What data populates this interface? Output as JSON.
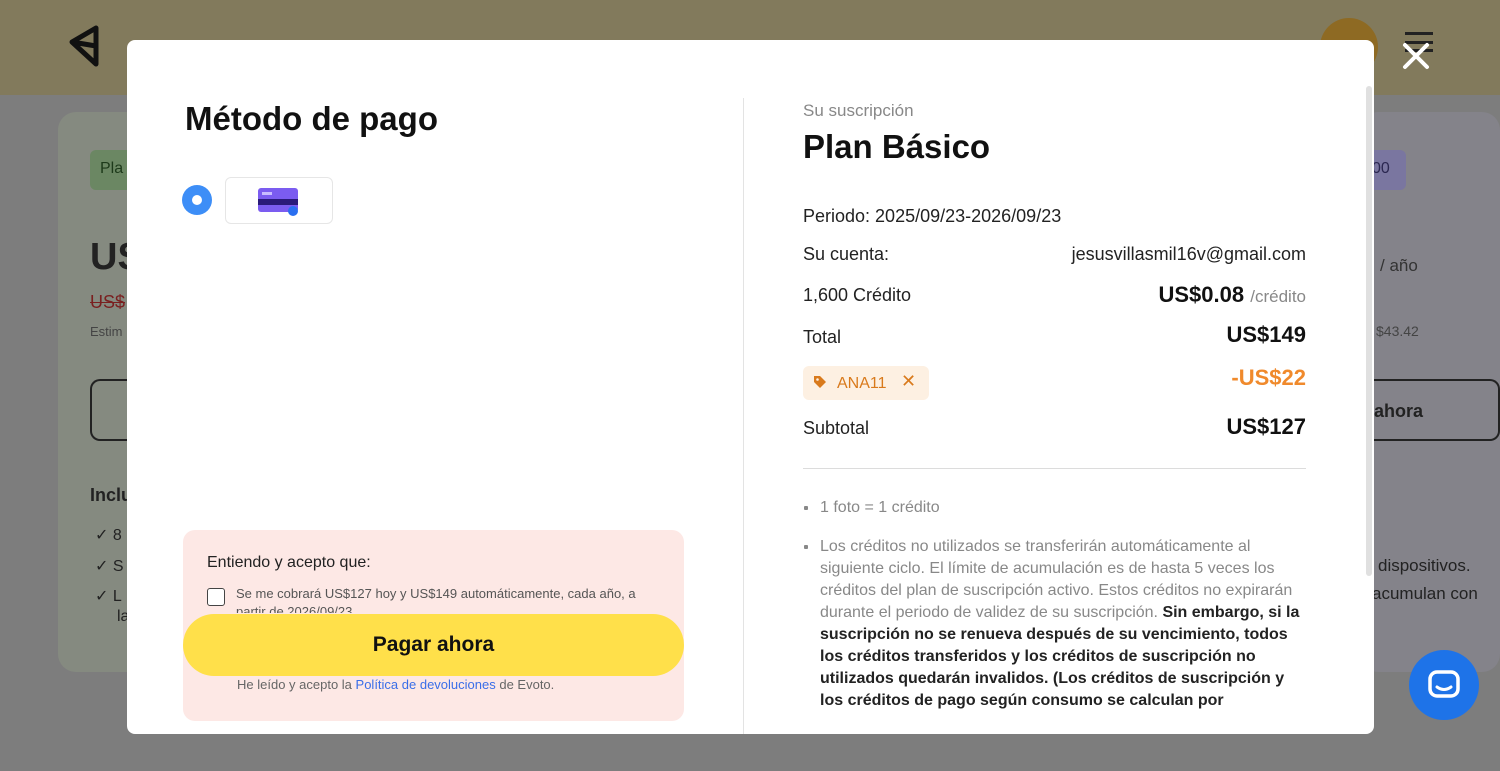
{
  "background": {
    "left_chip": "Pla",
    "right_chip": "00",
    "left_price": "US",
    "left_old_price": "US$",
    "left_estimate": "Estim",
    "left_includes": "Inclu",
    "left_items": [
      "8",
      "S",
      "L",
      "la"
    ],
    "right_per_year": "/ año",
    "right_amount": "$43.42",
    "right_button": "ahora",
    "right_text_1": "dispositivos.",
    "right_text_2": "acumulan con"
  },
  "modal": {
    "payment": {
      "title": "Método de pago",
      "card_label": "card",
      "consent_title": "Entiendo y acepto que:",
      "consent_text": "Se me cobrará US$127 hoy y US$149 automáticamente, cada año, a partir de 2026/09/23.",
      "pay_button": "Pagar ahora",
      "legal_prefix": "He leído y acepto la ",
      "legal_link": "Política de devoluciones",
      "legal_suffix": " de Evoto."
    },
    "summary": {
      "label": "Su suscripción",
      "plan": "Plan Básico",
      "period": "Periodo: 2025/09/23-2026/09/23",
      "account_label": "Su cuenta:",
      "account_value": "jesusvillasmil16v@gmail.com",
      "credits_label": "1,600 Crédito",
      "credit_price": "US$0.08",
      "credit_unit": "/crédito",
      "total_label": "Total",
      "total_value": "US$149",
      "coupon_code": "ANA11",
      "coupon_remove": "✕",
      "discount": "-US$22",
      "subtotal_label": "Subtotal",
      "subtotal_value": "US$127",
      "note_1": "1 foto = 1 crédito",
      "note_2_plain": "Los créditos no utilizados se transferirán automáticamente al siguiente ciclo. El límite de acumulación es de hasta 5 veces los créditos del plan de suscripción activo. Estos créditos no expirarán durante el periodo de validez de su suscripción. ",
      "note_2_bold": "Sin embargo, si la suscripción no se renueva después de su vencimiento, todos los créditos transferidos y los créditos de suscripción no utilizados quedarán invalidos. (Los créditos de suscripción y los créditos de pago según consumo se calculan por"
    }
  },
  "colors": {
    "accent_yellow": "#ffe04a",
    "radio_blue": "#3d8ef7",
    "coupon_orange": "#d97a1c",
    "discount_orange": "#f08a2c",
    "chat_blue": "#1e73e8"
  }
}
